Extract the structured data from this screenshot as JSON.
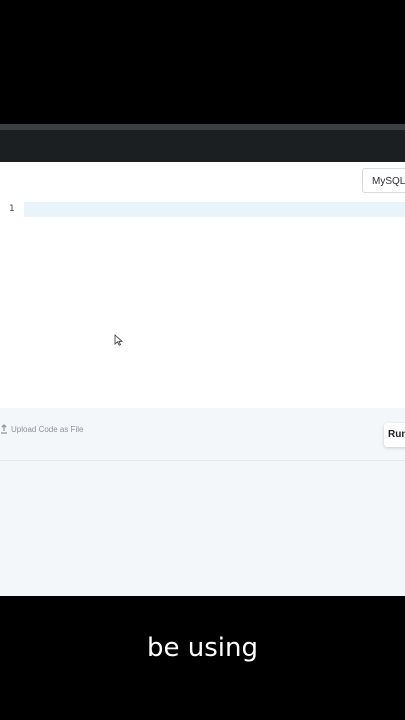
{
  "editor": {
    "language_select_value": "MySQL",
    "line_numbers": [
      "1"
    ]
  },
  "footer": {
    "upload_label": "Upload Code as File",
    "run_label": "Run"
  },
  "caption": {
    "text": "be using"
  }
}
